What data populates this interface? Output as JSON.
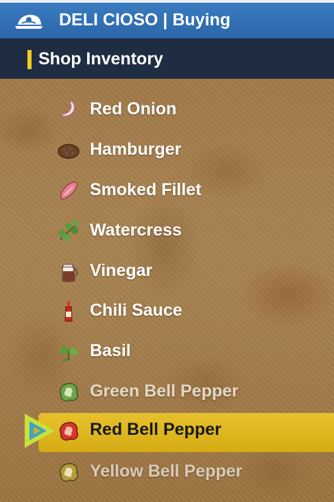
{
  "header": {
    "title": "DELI CIOSO | Buying",
    "logo_icon": "shop-logo-icon"
  },
  "section": {
    "title": "Shop Inventory"
  },
  "items": [
    {
      "label": "Red Onion",
      "icon": "red-onion-icon"
    },
    {
      "label": "Hamburger",
      "icon": "hamburger-patty-icon"
    },
    {
      "label": "Smoked Fillet",
      "icon": "smoked-fillet-icon"
    },
    {
      "label": "Watercress",
      "icon": "watercress-icon"
    },
    {
      "label": "Vinegar",
      "icon": "vinegar-jug-icon"
    },
    {
      "label": "Chili Sauce",
      "icon": "chili-sauce-bottle-icon"
    },
    {
      "label": "Basil",
      "icon": "basil-leaf-icon"
    },
    {
      "label": "Green Bell Pepper",
      "icon": "green-bell-pepper-icon"
    },
    {
      "label": "Red Bell Pepper",
      "icon": "red-bell-pepper-icon",
      "selected": true
    },
    {
      "label": "Yellow Bell Pepper",
      "icon": "yellow-bell-pepper-icon"
    }
  ],
  "colors": {
    "header": "#2f6fb5",
    "subheader": "#1f2d42",
    "accent": "#f3cd1f",
    "selection": "#dfb61f"
  }
}
